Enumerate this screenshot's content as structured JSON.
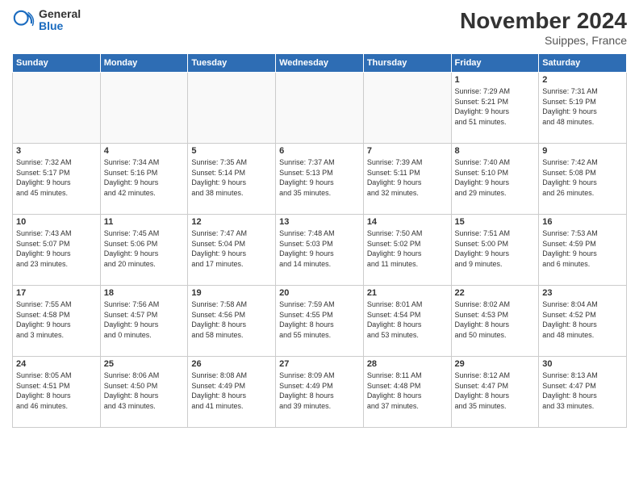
{
  "header": {
    "logo_general": "General",
    "logo_blue": "Blue",
    "title": "November 2024",
    "location": "Suippes, France"
  },
  "days_of_week": [
    "Sunday",
    "Monday",
    "Tuesday",
    "Wednesday",
    "Thursday",
    "Friday",
    "Saturday"
  ],
  "weeks": [
    [
      {
        "day": "",
        "info": ""
      },
      {
        "day": "",
        "info": ""
      },
      {
        "day": "",
        "info": ""
      },
      {
        "day": "",
        "info": ""
      },
      {
        "day": "",
        "info": ""
      },
      {
        "day": "1",
        "info": "Sunrise: 7:29 AM\nSunset: 5:21 PM\nDaylight: 9 hours\nand 51 minutes."
      },
      {
        "day": "2",
        "info": "Sunrise: 7:31 AM\nSunset: 5:19 PM\nDaylight: 9 hours\nand 48 minutes."
      }
    ],
    [
      {
        "day": "3",
        "info": "Sunrise: 7:32 AM\nSunset: 5:17 PM\nDaylight: 9 hours\nand 45 minutes."
      },
      {
        "day": "4",
        "info": "Sunrise: 7:34 AM\nSunset: 5:16 PM\nDaylight: 9 hours\nand 42 minutes."
      },
      {
        "day": "5",
        "info": "Sunrise: 7:35 AM\nSunset: 5:14 PM\nDaylight: 9 hours\nand 38 minutes."
      },
      {
        "day": "6",
        "info": "Sunrise: 7:37 AM\nSunset: 5:13 PM\nDaylight: 9 hours\nand 35 minutes."
      },
      {
        "day": "7",
        "info": "Sunrise: 7:39 AM\nSunset: 5:11 PM\nDaylight: 9 hours\nand 32 minutes."
      },
      {
        "day": "8",
        "info": "Sunrise: 7:40 AM\nSunset: 5:10 PM\nDaylight: 9 hours\nand 29 minutes."
      },
      {
        "day": "9",
        "info": "Sunrise: 7:42 AM\nSunset: 5:08 PM\nDaylight: 9 hours\nand 26 minutes."
      }
    ],
    [
      {
        "day": "10",
        "info": "Sunrise: 7:43 AM\nSunset: 5:07 PM\nDaylight: 9 hours\nand 23 minutes."
      },
      {
        "day": "11",
        "info": "Sunrise: 7:45 AM\nSunset: 5:06 PM\nDaylight: 9 hours\nand 20 minutes."
      },
      {
        "day": "12",
        "info": "Sunrise: 7:47 AM\nSunset: 5:04 PM\nDaylight: 9 hours\nand 17 minutes."
      },
      {
        "day": "13",
        "info": "Sunrise: 7:48 AM\nSunset: 5:03 PM\nDaylight: 9 hours\nand 14 minutes."
      },
      {
        "day": "14",
        "info": "Sunrise: 7:50 AM\nSunset: 5:02 PM\nDaylight: 9 hours\nand 11 minutes."
      },
      {
        "day": "15",
        "info": "Sunrise: 7:51 AM\nSunset: 5:00 PM\nDaylight: 9 hours\nand 9 minutes."
      },
      {
        "day": "16",
        "info": "Sunrise: 7:53 AM\nSunset: 4:59 PM\nDaylight: 9 hours\nand 6 minutes."
      }
    ],
    [
      {
        "day": "17",
        "info": "Sunrise: 7:55 AM\nSunset: 4:58 PM\nDaylight: 9 hours\nand 3 minutes."
      },
      {
        "day": "18",
        "info": "Sunrise: 7:56 AM\nSunset: 4:57 PM\nDaylight: 9 hours\nand 0 minutes."
      },
      {
        "day": "19",
        "info": "Sunrise: 7:58 AM\nSunset: 4:56 PM\nDaylight: 8 hours\nand 58 minutes."
      },
      {
        "day": "20",
        "info": "Sunrise: 7:59 AM\nSunset: 4:55 PM\nDaylight: 8 hours\nand 55 minutes."
      },
      {
        "day": "21",
        "info": "Sunrise: 8:01 AM\nSunset: 4:54 PM\nDaylight: 8 hours\nand 53 minutes."
      },
      {
        "day": "22",
        "info": "Sunrise: 8:02 AM\nSunset: 4:53 PM\nDaylight: 8 hours\nand 50 minutes."
      },
      {
        "day": "23",
        "info": "Sunrise: 8:04 AM\nSunset: 4:52 PM\nDaylight: 8 hours\nand 48 minutes."
      }
    ],
    [
      {
        "day": "24",
        "info": "Sunrise: 8:05 AM\nSunset: 4:51 PM\nDaylight: 8 hours\nand 46 minutes."
      },
      {
        "day": "25",
        "info": "Sunrise: 8:06 AM\nSunset: 4:50 PM\nDaylight: 8 hours\nand 43 minutes."
      },
      {
        "day": "26",
        "info": "Sunrise: 8:08 AM\nSunset: 4:49 PM\nDaylight: 8 hours\nand 41 minutes."
      },
      {
        "day": "27",
        "info": "Sunrise: 8:09 AM\nSunset: 4:49 PM\nDaylight: 8 hours\nand 39 minutes."
      },
      {
        "day": "28",
        "info": "Sunrise: 8:11 AM\nSunset: 4:48 PM\nDaylight: 8 hours\nand 37 minutes."
      },
      {
        "day": "29",
        "info": "Sunrise: 8:12 AM\nSunset: 4:47 PM\nDaylight: 8 hours\nand 35 minutes."
      },
      {
        "day": "30",
        "info": "Sunrise: 8:13 AM\nSunset: 4:47 PM\nDaylight: 8 hours\nand 33 minutes."
      }
    ]
  ]
}
